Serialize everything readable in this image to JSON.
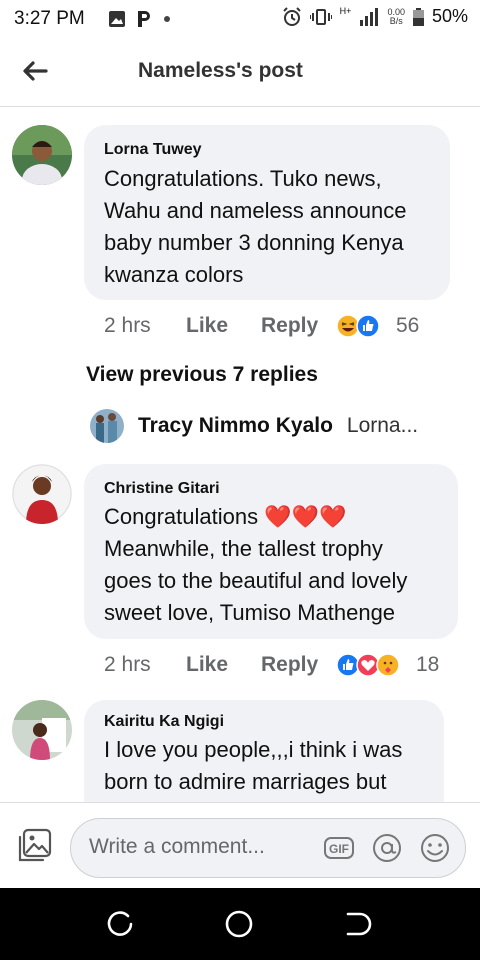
{
  "status_bar": {
    "time": "3:27 PM",
    "network_type": "H+",
    "speed_value": "0.00",
    "speed_unit": "B/s",
    "battery": "50%"
  },
  "header": {
    "title": "Nameless's post"
  },
  "comments": [
    {
      "author": "Lorna Tuwey",
      "text_lines": [
        "Congratulations. Tuko news,",
        "Wahu and nameless announce",
        "baby number 3 donning Kenya",
        "kwanza colors"
      ],
      "time": "2 hrs",
      "like_label": "Like",
      "reply_label": "Reply",
      "reaction_count": "56",
      "reactions": [
        "haha-icon",
        "like-reaction-icon"
      ]
    },
    {
      "author": "Christine Gitari",
      "text_lines": [
        "Congratulations",
        "Meanwhile, the tallest trophy",
        "goes to the beautiful and lovely",
        "sweet love, Tumiso Mathenge"
      ],
      "hearts": "❤️❤️❤️",
      "time": "2 hrs",
      "like_label": "Like",
      "reply_label": "Reply",
      "reaction_count": "18",
      "reactions": [
        "like-reaction-icon",
        "love-reaction-icon",
        "care-reaction-icon"
      ]
    },
    {
      "author": "Kairitu Ka Ngigi",
      "text_lines": [
        "I love you people,,,i think i was",
        "born to admire marriages but"
      ]
    }
  ],
  "replies": {
    "view_previous": "View previous 7 replies",
    "latest_reply_author": "Tracy Nimmo Kyalo",
    "latest_reply_snippet": "Lorna..."
  },
  "composer": {
    "placeholder": "Write a comment...",
    "gif_label": "GIF"
  },
  "colors": {
    "bubble_bg": "#f0f2f5",
    "like_blue": "#1877f2",
    "love_red": "#f33e58",
    "haha_yellow": "#f7b125",
    "meta_gray": "#65676b"
  }
}
